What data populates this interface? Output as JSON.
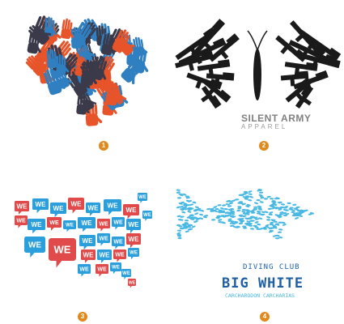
{
  "colors": {
    "badge": "#e08a1e",
    "hands_blue": "#2f7fc1",
    "hands_orange": "#e8542a",
    "hands_dark": "#3a3a4a",
    "army_black": "#1a1a1a",
    "army_gray": "#808080",
    "we_blue": "#2b9fdc",
    "we_red": "#e04a4a",
    "shark_blue": "#49b9e3",
    "shark_text": "#1f5fa8"
  },
  "panels": [
    {
      "badge": "1",
      "logo_name": "hands-heart-logo"
    },
    {
      "badge": "2",
      "logo_name": "silent-army-butterfly-logo",
      "title": "SILENT ARMY",
      "subtitle": "APPAREL"
    },
    {
      "badge": "3",
      "logo_name": "we-speech-bubble-usa-map",
      "bubble_text": "WE"
    },
    {
      "badge": "4",
      "logo_name": "big-white-shark-logo",
      "line1": "DIVING CLUB",
      "line2": "BIG WHITE",
      "line3": "CARCHARODON CARCHARIAS"
    }
  ]
}
